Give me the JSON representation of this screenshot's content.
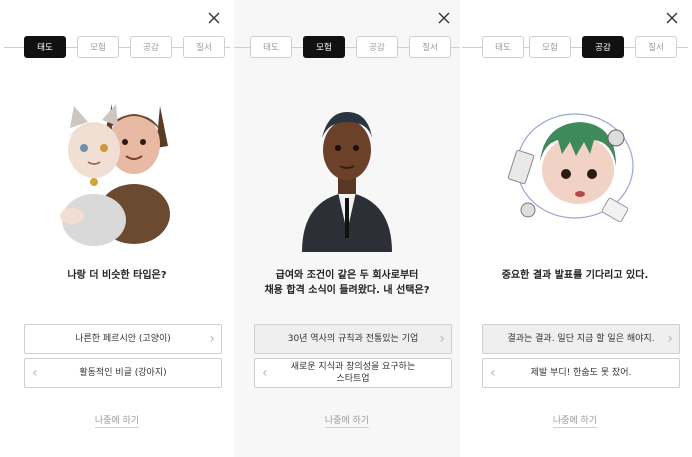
{
  "panels": [
    {
      "steps": [
        "태도",
        "모험",
        "공감",
        "질서"
      ],
      "active_step": 0,
      "question": "나랑 더 비슷한 타입은?",
      "options": [
        "나른한 페르시안 (고양이)",
        "활동적인 비글 (강아지)"
      ],
      "later": "나중에 하기"
    },
    {
      "steps": [
        "태도",
        "모험",
        "공감",
        "질서"
      ],
      "active_step": 1,
      "question": "급여와 조건이 같은 두 회사로부터\n채용 합격 소식이 들려왔다. 내 선택은?",
      "options": [
        "30년 역사의 규칙과 전통있는 기업",
        "새로운 지식과 창의성을 요구하는\n스타트업"
      ],
      "later": "나중에 하기"
    },
    {
      "steps": [
        "태도",
        "모험",
        "공감",
        "질서"
      ],
      "active_step": 2,
      "question": "중요한 결과 발표를 기다리고 있다.",
      "options": [
        "결과는 결과. 일단 지금 할 일은 해야지.",
        "제발 부디! 한숨도 못 잤어."
      ],
      "later": "나중에 하기"
    }
  ],
  "icons": {
    "close": "close-icon",
    "chevron_right": "chevron-right-icon",
    "chevron_left": "chevron-left-icon"
  },
  "colors": {
    "active_step_bg": "#111111",
    "border": "#cfcfcf",
    "text_muted": "#9a9a9a"
  }
}
